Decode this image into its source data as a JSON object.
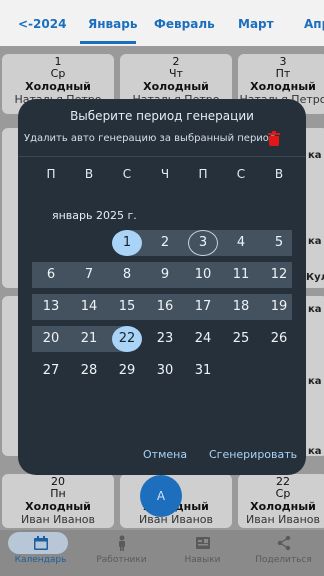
{
  "tabs": [
    "<-2024",
    "Январь",
    "Февраль",
    "Март",
    "Апр"
  ],
  "cards_top": [
    {
      "num": "1",
      "dow": "Ср",
      "type": "Холодный",
      "person": "Наталья Петро"
    },
    {
      "num": "2",
      "dow": "Чт",
      "type": "Холодный",
      "person": "Наталья Петро"
    },
    {
      "num": "3",
      "dow": "Пт",
      "type": "Холодный",
      "person": "Наталья Петро"
    }
  ],
  "cards_bottom": [
    {
      "num": "20",
      "dow": "Пн",
      "type": "Холодный",
      "person": "Иван Иванов"
    },
    {
      "num": "",
      "dow": "",
      "type": "Холодный",
      "person": "Иван Иванов"
    },
    {
      "num": "22",
      "dow": "Ср",
      "type": "Холодный",
      "person": "Иван Иванов"
    }
  ],
  "side_fragments": [
    "ка",
    "ка",
    "Кула",
    "ка",
    "ка",
    "ка"
  ],
  "fab_label": "А",
  "dialog": {
    "title": "Выберите период генерации",
    "delete_text": "Удалить авто генерацию за выбранный период",
    "weekdays": [
      "П",
      "В",
      "С",
      "Ч",
      "П",
      "С",
      "В"
    ],
    "month_label": "январь 2025 г.",
    "weeks": [
      [
        "",
        "",
        "1",
        "2",
        "3",
        "4",
        "5"
      ],
      [
        "6",
        "7",
        "8",
        "9",
        "10",
        "11",
        "12"
      ],
      [
        "13",
        "14",
        "15",
        "16",
        "17",
        "18",
        "19"
      ],
      [
        "20",
        "21",
        "22",
        "23",
        "24",
        "25",
        "26"
      ],
      [
        "27",
        "28",
        "29",
        "30",
        "31",
        "",
        ""
      ]
    ],
    "selected_start": "1",
    "selected_end": "22",
    "today": "3",
    "cancel_label": "Отмена",
    "generate_label": "Сгенерировать"
  },
  "bottom_nav": [
    {
      "label": "Календарь",
      "icon": "calendar-icon"
    },
    {
      "label": "Работники",
      "icon": "person-icon"
    },
    {
      "label": "Навыки",
      "icon": "skills-icon"
    },
    {
      "label": "Поделиться",
      "icon": "share-icon"
    }
  ],
  "colors": {
    "accent": "#1c6fbd",
    "dialog_bg": "#25303b",
    "selection": "#a9d3f7",
    "range": "#44525f",
    "danger": "#e01818"
  }
}
